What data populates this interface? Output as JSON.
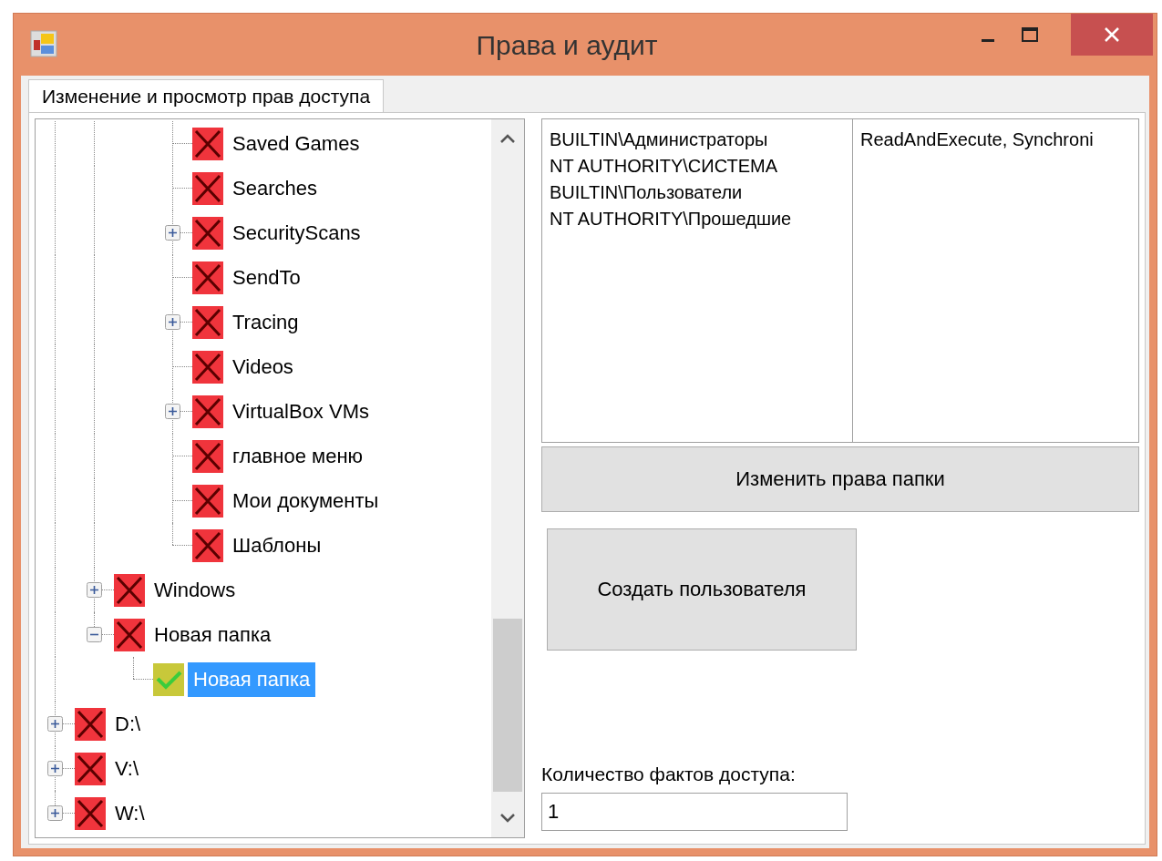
{
  "window": {
    "title": "Права и аудит"
  },
  "tabs": [
    {
      "label": "Изменение и просмотр прав доступа",
      "selected": true
    }
  ],
  "tree": {
    "nodes": [
      {
        "children": [
          {
            "children": [
              {
                "children": [
                  {
                    "label": "Saved Games",
                    "kind": "denied",
                    "selected": false
                  },
                  {
                    "label": "Searches",
                    "kind": "denied",
                    "selected": false
                  },
                  {
                    "label": "SecurityScans",
                    "kind": "denied",
                    "expanded": false,
                    "selected": false
                  },
                  {
                    "label": "SendTo",
                    "kind": "denied",
                    "selected": false
                  },
                  {
                    "label": "Tracing",
                    "kind": "denied",
                    "expanded": false,
                    "selected": false
                  },
                  {
                    "label": "Videos",
                    "kind": "denied",
                    "selected": false
                  },
                  {
                    "label": "VirtualBox VMs",
                    "kind": "denied",
                    "expanded": false,
                    "selected": false
                  },
                  {
                    "label": "главное меню",
                    "kind": "denied",
                    "selected": false
                  },
                  {
                    "label": "Мои документы",
                    "kind": "denied",
                    "selected": false
                  },
                  {
                    "label": "Шаблоны",
                    "kind": "denied",
                    "selected": false
                  }
                ]
              }
            ]
          },
          {
            "label": "Windows",
            "kind": "denied",
            "expanded": false,
            "selected": false
          },
          {
            "label": "Новая папка",
            "kind": "denied",
            "expanded": true,
            "selected": false,
            "children": [
              {
                "label": "Новая папка",
                "kind": "granted",
                "selected": true
              }
            ]
          }
        ]
      },
      {
        "label": "D:\\",
        "kind": "denied",
        "expanded": false,
        "selected": false
      },
      {
        "label": "V:\\",
        "kind": "denied",
        "expanded": false,
        "selected": false
      },
      {
        "label": "W:\\",
        "kind": "denied",
        "expanded": false,
        "selected": false
      }
    ]
  },
  "acl_list": {
    "columns": [
      {
        "lines": [
          "BUILTIN\\Администраторы",
          "NT AUTHORITY\\СИСТЕМА",
          "BUILTIN\\Пользователи",
          "NT AUTHORITY\\Прошедшие"
        ]
      },
      {
        "lines": [
          "ReadAndExecute, Synchroni"
        ]
      }
    ]
  },
  "buttons": [
    {
      "label": "Изменить права папки",
      "kind": "wide"
    },
    {
      "label": "Создать пользователя",
      "kind": "large"
    }
  ],
  "access_count": {
    "label": "Количество фактов доступа:",
    "value": "1"
  }
}
